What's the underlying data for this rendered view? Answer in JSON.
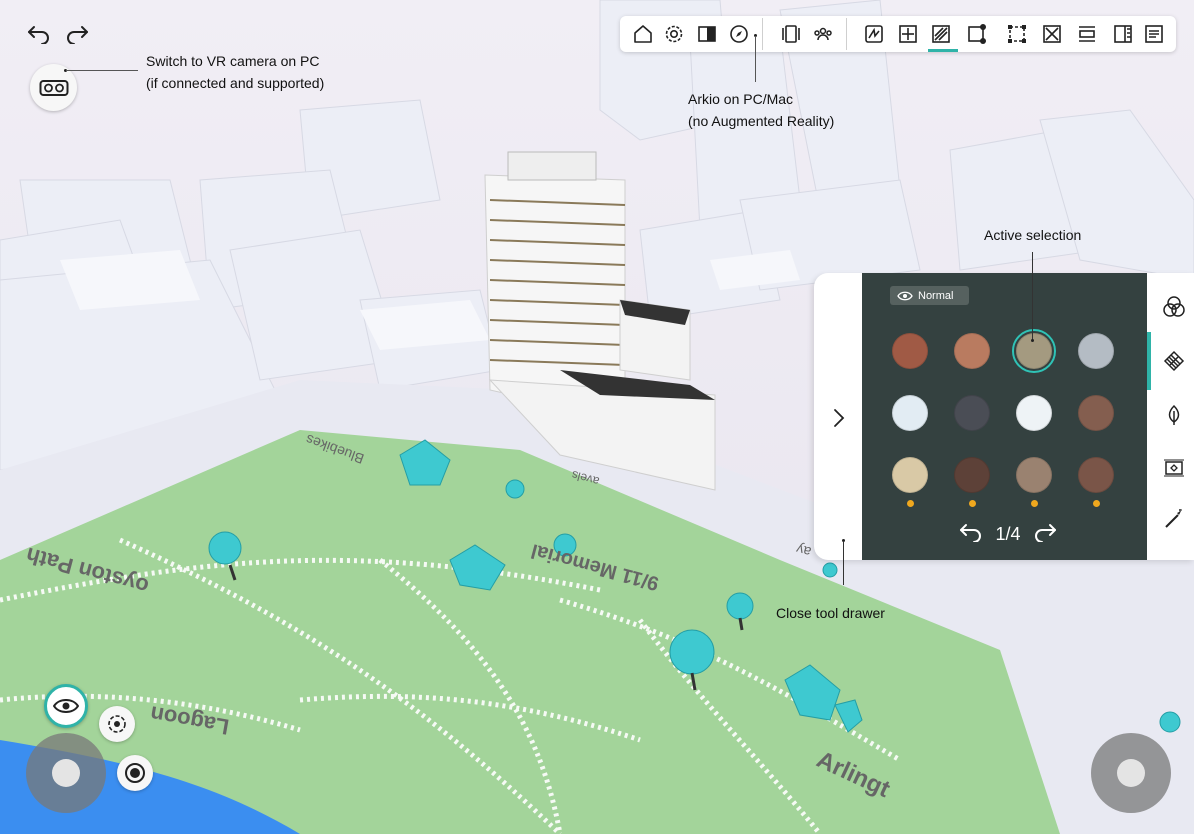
{
  "colors": {
    "accent": "#2fb3a8",
    "selection_ring": "#2fc3b6",
    "palette_bg": "#344140",
    "badge_dot": "#f0a81e"
  },
  "history": {
    "undo_icon": "undo-arrow-icon",
    "redo_icon": "redo-arrow-icon"
  },
  "annotations": {
    "vr_camera": "Switch to VR camera on PC\n(if connected and supported)",
    "vr_camera_line1": "Switch to VR camera on PC",
    "vr_camera_line2": "(if connected and supported)",
    "platform_line1": "Arkio on PC/Mac",
    "platform_line2": "(no Augmented Reality)",
    "active_selection": "Active selection",
    "close_drawer": "Close tool drawer"
  },
  "toolbar": {
    "items": [
      {
        "icon": "home-icon"
      },
      {
        "icon": "gear-icon"
      },
      {
        "icon": "split-view-icon"
      },
      {
        "icon": "compass-icon"
      },
      {
        "icon": "tablet-icon"
      },
      {
        "icon": "users-icon"
      },
      {
        "icon": "draw-icon"
      },
      {
        "icon": "add-box-icon"
      },
      {
        "icon": "material-icon",
        "active": true
      },
      {
        "icon": "resize-icon"
      },
      {
        "icon": "transform-icon"
      },
      {
        "icon": "delete-box-icon"
      },
      {
        "icon": "align-icon"
      },
      {
        "icon": "measure-icon"
      },
      {
        "icon": "notes-icon"
      }
    ]
  },
  "drawer": {
    "mode_label": "Normal",
    "page_label": "1/4",
    "selected_index": 2,
    "swatches": [
      {
        "color": "#a05a45",
        "dot": false
      },
      {
        "color": "#b97b60",
        "dot": false
      },
      {
        "color": "#a49a80",
        "dot": false
      },
      {
        "color": "#b4bcc4",
        "dot": false
      },
      {
        "color": "#e2ecf3",
        "dot": false
      },
      {
        "color": "#4a4d55",
        "dot": false
      },
      {
        "color": "#eef3f6",
        "dot": false
      },
      {
        "color": "#845e4f",
        "dot": false
      },
      {
        "color": "#d9c9a6",
        "dot": true
      },
      {
        "color": "#5d4138",
        "dot": true
      },
      {
        "color": "#9a8270",
        "dot": true
      },
      {
        "color": "#7a5548",
        "dot": true
      }
    ],
    "side_tabs": [
      {
        "icon": "color-mix-icon"
      },
      {
        "icon": "texture-pattern-icon",
        "active": true
      },
      {
        "icon": "leaf-icon"
      },
      {
        "icon": "image-frame-icon"
      },
      {
        "icon": "magic-wand-icon"
      }
    ]
  },
  "scene": {
    "street_labels": [
      "Bluebikes",
      "oyston Path",
      "9/11 Memorial",
      "Lagoon",
      "Arlingt",
      "avels",
      "ay"
    ]
  }
}
